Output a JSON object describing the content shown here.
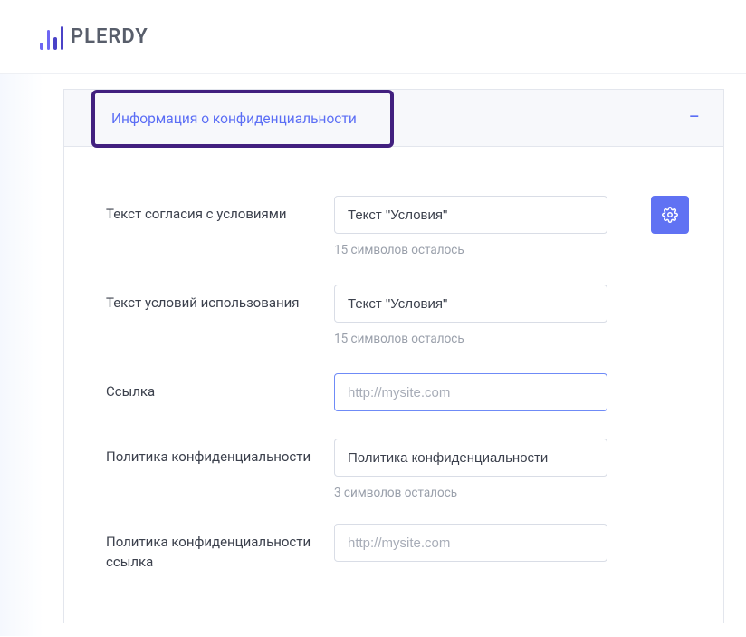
{
  "brand": {
    "name": "PLERDY"
  },
  "panel": {
    "title": "Информация о конфиденциальности"
  },
  "fields": {
    "agreeText": {
      "label": "Текст согласия с условиями",
      "value": "Текст \"Условия\"",
      "hint": "15 символов осталось"
    },
    "termsText": {
      "label": "Текст условий использования",
      "value": "Текст \"Условия\"",
      "hint": "15 символов осталось"
    },
    "link": {
      "label": "Ссылка",
      "placeholder": "http://mysite.com"
    },
    "privacyPolicy": {
      "label": "Политика конфиденциальности",
      "value": "Политика конфиденциальности",
      "hint": "3 символов осталось"
    },
    "privacyPolicyLink": {
      "label": "Политика конфиденциальности ссылка",
      "placeholder": "http://mysite.com"
    }
  }
}
